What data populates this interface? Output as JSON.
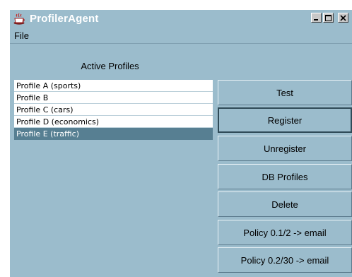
{
  "window": {
    "title": "ProfilerAgent",
    "controls": [
      "minimize",
      "maximize",
      "close"
    ]
  },
  "menu": {
    "file_label": "File"
  },
  "profiles": {
    "heading": "Active Profiles",
    "items": [
      {
        "label": "Profile A (sports)",
        "selected": false
      },
      {
        "label": "Profile B",
        "selected": false
      },
      {
        "label": "Profile C (cars)",
        "selected": false
      },
      {
        "label": "Profile D (economics)",
        "selected": false
      },
      {
        "label": "Profile E (traffic)",
        "selected": true
      }
    ]
  },
  "buttons": {
    "test": "Test",
    "register": "Register",
    "unregister": "Unregister",
    "db_profiles": "DB Profiles",
    "delete": "Delete",
    "policy_1": "Policy 0.1/2 -> email",
    "policy_2": "Policy 0.2/30 -> email"
  },
  "colors": {
    "window_bg": "#9bbccc",
    "selection": "#577f92",
    "title_text": "#ffffff"
  }
}
